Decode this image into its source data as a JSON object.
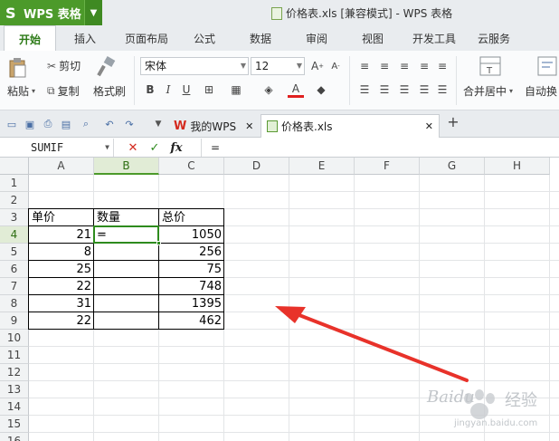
{
  "titlebar": {
    "app_logo": "S",
    "app_name": "WPS 表格",
    "caret": "▼",
    "window_title": "价格表.xls [兼容模式] - WPS 表格"
  },
  "tabs": [
    {
      "label": "开始",
      "active": true
    },
    {
      "label": "插入"
    },
    {
      "label": "页面布局"
    },
    {
      "label": "公式"
    },
    {
      "label": "数据"
    },
    {
      "label": "审阅"
    },
    {
      "label": "视图"
    },
    {
      "label": "开发工具"
    },
    {
      "label": "云服务"
    }
  ],
  "ribbon": {
    "paste_label": "粘贴",
    "cut_label": "剪切",
    "copy_label": "复制",
    "format_painter_label": "格式刷",
    "font_name": "宋体",
    "font_size": "12",
    "merge_center_label": "合并居中",
    "wrap_label": "自动换"
  },
  "docbar": {
    "tab1_label": "我的WPS",
    "tab2_label": "价格表.xls",
    "add_tab": "+"
  },
  "formula_bar": {
    "name_box": "SUMIF",
    "cancel": "✕",
    "confirm": "✓",
    "fx": "fx",
    "content": "="
  },
  "sheet": {
    "columns": [
      "A",
      "B",
      "C",
      "D",
      "E",
      "F",
      "G",
      "H"
    ],
    "rows": [
      "1",
      "2",
      "3",
      "4",
      "5",
      "6",
      "7",
      "8",
      "9",
      "10",
      "11",
      "12",
      "13",
      "14",
      "15",
      "16"
    ],
    "header_row": {
      "a": "单价",
      "b": "数量",
      "c": "总价"
    },
    "data": [
      {
        "a": "21",
        "b": "=",
        "c": "1050"
      },
      {
        "a": "8",
        "b": "",
        "c": "256"
      },
      {
        "a": "25",
        "b": "",
        "c": "75"
      },
      {
        "a": "22",
        "b": "",
        "c": "748"
      },
      {
        "a": "31",
        "b": "",
        "c": "1395"
      },
      {
        "a": "22",
        "b": "",
        "c": "462"
      }
    ],
    "active_cell": "B4"
  },
  "colors": {
    "accent": "#4c9a2a",
    "annotation_arrow": "#e8322a"
  },
  "watermark": {
    "brand": "Baidu",
    "word": "经验",
    "url": "jingyan.baidu.com"
  }
}
